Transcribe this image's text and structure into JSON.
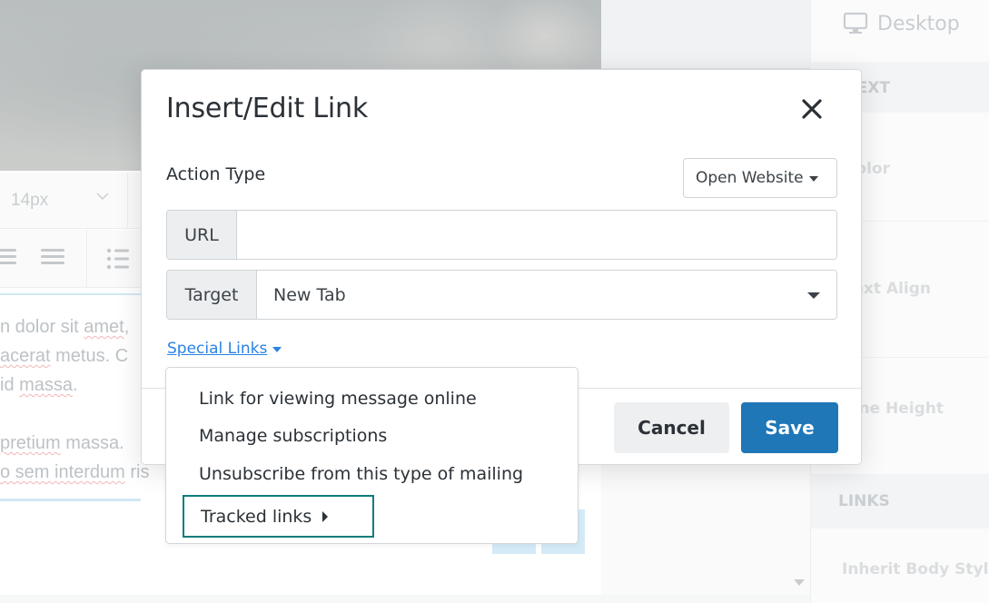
{
  "background": {
    "toolbar": {
      "font_size_value": "14px"
    },
    "editor_text_lines": [
      {
        "prefix": "n dolor sit ",
        "squiggle": "amet",
        "suffix": ","
      },
      {
        "prefix": "",
        "squiggle": "acerat",
        "suffix": " metus. C",
        "squiggle2": "metus"
      },
      {
        "prefix": " id ",
        "squiggle": "massa",
        "suffix": "."
      },
      {
        "prefix": "",
        "squiggle": "",
        "suffix": ""
      },
      {
        "prefix": "",
        "squiggle": "pretium",
        "suffix": " massa."
      },
      {
        "prefix": "",
        "squiggle": "o sem interdum",
        "suffix": " ris"
      }
    ],
    "sidebar": {
      "device_label": "Desktop",
      "labels": [
        "TEXT",
        "Color",
        "Text Align",
        "Line Height",
        "LINKS",
        "Inherit Body Style"
      ]
    }
  },
  "modal": {
    "title": "Insert/Edit Link",
    "close_icon": "close-icon",
    "action_type": {
      "label": "Action Type",
      "selected": "Open Website"
    },
    "url": {
      "addon": "URL",
      "value": "",
      "placeholder": ""
    },
    "target": {
      "addon": "Target",
      "selected": "New Tab"
    },
    "special_links": {
      "label": "Special Links",
      "items": [
        {
          "label": "Link for viewing message online"
        },
        {
          "label": "Manage subscriptions"
        },
        {
          "label": "Unsubscribe from this type of mailing"
        },
        {
          "label": "Tracked links",
          "has_submenu": true,
          "focused": true
        }
      ]
    },
    "buttons": {
      "cancel": "Cancel",
      "save": "Save"
    }
  },
  "colors": {
    "primary": "#1f77b8",
    "link": "#2a82e4",
    "focus_outline": "#0e7c7b"
  }
}
